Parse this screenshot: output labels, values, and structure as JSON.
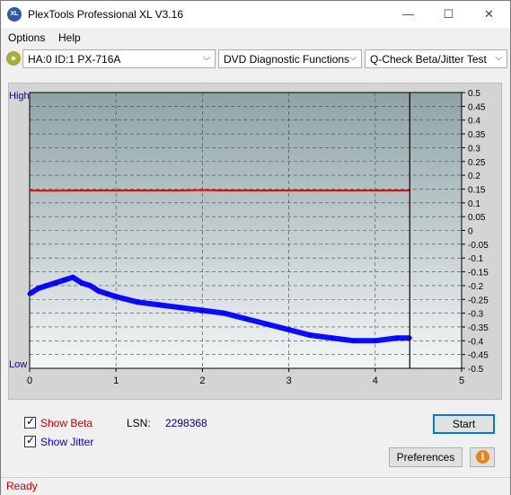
{
  "window": {
    "title": "PlexTools Professional XL V3.16",
    "icon_label": "XL",
    "minimize_glyph": "—",
    "maximize_glyph": "☐",
    "close_glyph": "✕"
  },
  "menu": [
    {
      "label": "Options"
    },
    {
      "label": "Help"
    }
  ],
  "toolbar": {
    "drive": "HA:0 ID:1  PX-716A",
    "function": "DVD Diagnostic Functions",
    "test": "Q-Check Beta/Jitter Test",
    "arrow_glyph": "⌵"
  },
  "chart_data": {
    "type": "line",
    "left_axis_labels": {
      "top": "High",
      "bottom": "Low"
    },
    "x_ticks": [
      "0",
      "1",
      "2",
      "3",
      "4",
      "5"
    ],
    "xlim": [
      0,
      5
    ],
    "y_ticks": [
      "0.5",
      "0.45",
      "0.4",
      "0.35",
      "0.3",
      "0.25",
      "0.2",
      "0.15",
      "0.1",
      "0.05",
      "0",
      "-0.05",
      "-0.1",
      "-0.15",
      "-0.2",
      "-0.25",
      "-0.3",
      "-0.35",
      "-0.4",
      "-0.45",
      "-0.5"
    ],
    "ylim": [
      -0.5,
      0.5
    ],
    "grid": true,
    "end_marker_x": 4.4,
    "colors": {
      "jitter": "#ff0000",
      "beta": "#0000ff",
      "gradient_top": "#8fa3a6",
      "gradient_bottom": "#f4f6f6"
    },
    "series": [
      {
        "key": "jitter",
        "x": [
          0.0,
          0.25,
          0.5,
          0.75,
          1.0,
          1.25,
          1.5,
          1.75,
          2.0,
          2.25,
          2.5,
          2.75,
          3.0,
          3.25,
          3.5,
          3.75,
          4.0,
          4.25,
          4.4
        ],
        "y": [
          0.145,
          0.144,
          0.145,
          0.145,
          0.145,
          0.145,
          0.145,
          0.145,
          0.146,
          0.145,
          0.145,
          0.145,
          0.145,
          0.145,
          0.145,
          0.145,
          0.145,
          0.145,
          0.145
        ]
      },
      {
        "key": "beta",
        "x": [
          0.0,
          0.1,
          0.2,
          0.3,
          0.4,
          0.5,
          0.6,
          0.7,
          0.8,
          0.9,
          1.0,
          1.25,
          1.5,
          1.75,
          2.0,
          2.25,
          2.5,
          2.75,
          3.0,
          3.25,
          3.5,
          3.75,
          4.0,
          4.25,
          4.4
        ],
        "y": [
          -0.23,
          -0.21,
          -0.2,
          -0.19,
          -0.18,
          -0.17,
          -0.19,
          -0.2,
          -0.22,
          -0.23,
          -0.24,
          -0.26,
          -0.27,
          -0.28,
          -0.29,
          -0.3,
          -0.32,
          -0.34,
          -0.36,
          -0.38,
          -0.39,
          -0.4,
          -0.4,
          -0.39,
          -0.39
        ]
      }
    ]
  },
  "options": {
    "show_beta": {
      "label": "Show Beta",
      "checked": true,
      "color": "#c00000"
    },
    "show_jitter": {
      "label": "Show Jitter",
      "checked": true,
      "color": "#0000c0"
    },
    "check_glyph": "✓"
  },
  "lsn": {
    "label": "LSN:",
    "value": "2298368",
    "value_color": "#000080"
  },
  "buttons": {
    "start": "Start",
    "preferences": "Preferences",
    "info_glyph": "i"
  },
  "status": "Ready"
}
